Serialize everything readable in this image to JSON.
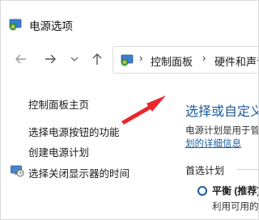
{
  "window": {
    "title": "电源选项"
  },
  "nav": {
    "back_icon": "arrow-left-icon",
    "forward_icon": "arrow-right-icon",
    "recent_icon": "chevron-down-icon",
    "up_icon": "arrow-up-icon",
    "breadcrumbs": [
      {
        "label": "控制面板"
      },
      {
        "label": "硬件和声音"
      }
    ]
  },
  "sidebar": {
    "items": [
      {
        "label": "控制面板主页"
      },
      {
        "label": "选择电源按钮的功能"
      },
      {
        "label": "创建电源计划"
      },
      {
        "label": "选择关闭显示器的时间"
      }
    ]
  },
  "main": {
    "heading": "选择或自定义电源计划",
    "description": "电源计划是用于管理计算机如何使用电源的",
    "link": "划的详细信息",
    "plans_label": "首选计划",
    "plans": [
      {
        "name": "平衡 (推荐)",
        "description": "利用可用的硬件自动平衡功耗与性能",
        "selected": true
      }
    ]
  },
  "annotation": {
    "color": "#e8282a"
  },
  "colors": {
    "link": "#1a5c9e",
    "accent": "#1a5c9e"
  }
}
